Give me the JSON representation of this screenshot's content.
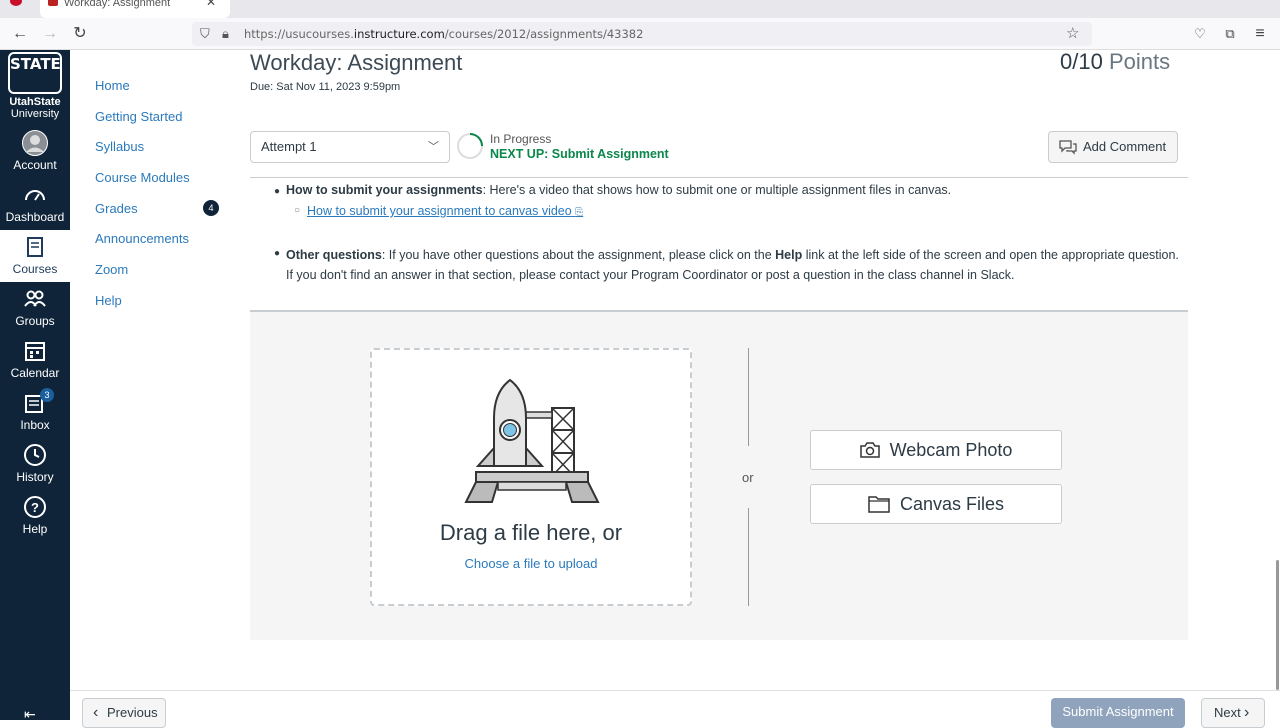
{
  "browser": {
    "tab_title": "Workday: Assignment",
    "url_prefix": "https://usucourses.",
    "url_domain": "instructure.com",
    "url_path": "/courses/2012/assignments/43382"
  },
  "global_nav": {
    "logo_top": "STATE",
    "logo_line1": "UtahState",
    "logo_line2": "University",
    "items": [
      {
        "label": "Account"
      },
      {
        "label": "Dashboard"
      },
      {
        "label": "Courses"
      },
      {
        "label": "Groups"
      },
      {
        "label": "Calendar"
      },
      {
        "label": "Inbox",
        "badge": "3"
      },
      {
        "label": "History"
      },
      {
        "label": "Help"
      }
    ]
  },
  "course_nav": {
    "items": [
      "Home",
      "Getting Started",
      "Syllabus",
      "Course Modules",
      "Grades",
      "Announcements",
      "Zoom",
      "Help"
    ],
    "grades_badge": "4"
  },
  "assignment": {
    "title": "Workday: Assignment",
    "due": "Due: Sat Nov 11, 2023 9:59pm",
    "points_score": "0/10",
    "points_label": "Points",
    "attempt": "Attempt 1",
    "status": "In Progress",
    "next_up": "NEXT UP: Submit Assignment",
    "add_comment": "Add Comment"
  },
  "instructions": {
    "how_bold": "How to submit your assignments",
    "how_text": ":  Here's a video that shows how to submit one or multiple assignment files in canvas.",
    "how_link": "How to submit your assignment to canvas video",
    "other_bold": "Other questions",
    "other_text1": ": If you have other questions about the assignment, please click on the ",
    "other_help": "Help",
    "other_text2": " link at the left side of the screen and open the appropriate question. If you don't find an answer in that section, please contact your Program Coordinator or post a question in the class channel in Slack."
  },
  "upload": {
    "drag_text": "Drag a file here, or",
    "choose_text": "Choose a file to upload",
    "or": "or",
    "webcam": "Webcam Photo",
    "canvas_files": "Canvas Files"
  },
  "footer": {
    "previous": "Previous",
    "submit": "Submit Assignment",
    "next": "Next"
  }
}
